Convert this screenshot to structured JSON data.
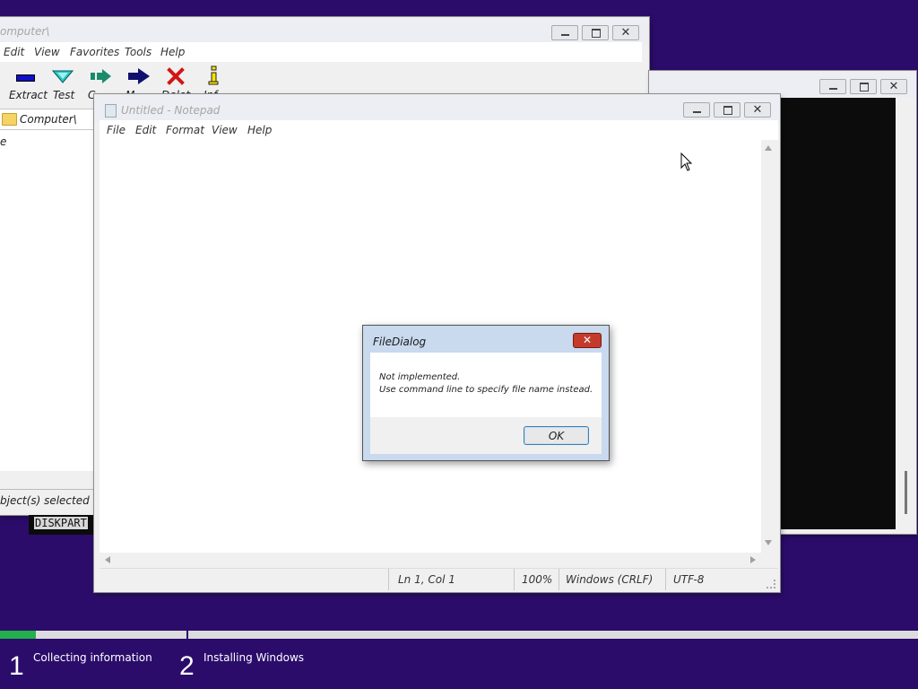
{
  "seven_zip_window": {
    "title": "omputer\\",
    "menu": [
      "Edit",
      "View",
      "Favorites",
      "Tools",
      "Help"
    ],
    "toolbar": [
      {
        "label": "Extract",
        "icon": "minus-icon"
      },
      {
        "label": "Test",
        "icon": "check-icon"
      },
      {
        "label": "C",
        "icon": "copy-arrow-icon"
      },
      {
        "label": "M",
        "icon": "move-arrow-icon"
      },
      {
        "label": "Delet",
        "icon": "delete-x-icon"
      },
      {
        "label": "Inf",
        "icon": "info-icon"
      }
    ],
    "address": "Computer\\",
    "list_item": "e",
    "status": "bject(s) selected"
  },
  "console_window": {
    "diskpart_text": "DISKPART"
  },
  "notepad": {
    "title": "Untitled - Notepad",
    "menu": [
      "File",
      "Edit",
      "Format",
      "View",
      "Help"
    ],
    "status": {
      "position": "Ln 1, Col 1",
      "zoom": "100%",
      "line_ending": "Windows (CRLF)",
      "encoding": "UTF-8"
    }
  },
  "dialog": {
    "title": "FileDialog",
    "line1": "Not implemented.",
    "line2": "Use command line to specify file name instead.",
    "ok_label": "OK"
  },
  "setup": {
    "progress": 0.19,
    "steps": [
      {
        "number": "1",
        "label": "Collecting information"
      },
      {
        "number": "2",
        "label": "Installing Windows"
      }
    ]
  },
  "colors": {
    "desktop": "#2b0c6b",
    "progress_fill": "#22b14c",
    "delete_red": "#d21414",
    "info_yellow": "#f5e400"
  }
}
